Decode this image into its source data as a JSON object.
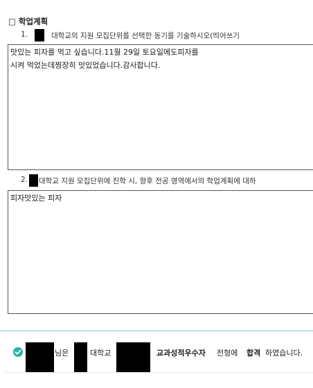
{
  "section": {
    "heading": "□ 학업계획"
  },
  "question1": {
    "number": "1.",
    "text": "대학교의 지원 모집단위를 선택한 동기를 기술하시오(띄어쓰기",
    "answer_lines": [
      "맛있는 피자를 먹고 싶습니다.11월 29일 토요일에도피자를",
      "시켜 먹었는데찡장히 맛있었습니다.감사합니다."
    ]
  },
  "question2": {
    "number": "2.",
    "text": "대학교 지원 모집단위에 진학 시, 향후 전공 영역에서의 학업계획에 대하",
    "answer_lines": [
      "피자맛있는 피자"
    ]
  },
  "result": {
    "part1": "님은",
    "part2": "대학교",
    "part3": "교과성적우수자",
    "part4": "전형에",
    "part5": "합격",
    "part6": "하였습니다."
  },
  "colors": {
    "check": "#2bb3a5",
    "teal_divider": "#7fc9c4"
  },
  "icons": {
    "result": "check-circle-icon"
  }
}
